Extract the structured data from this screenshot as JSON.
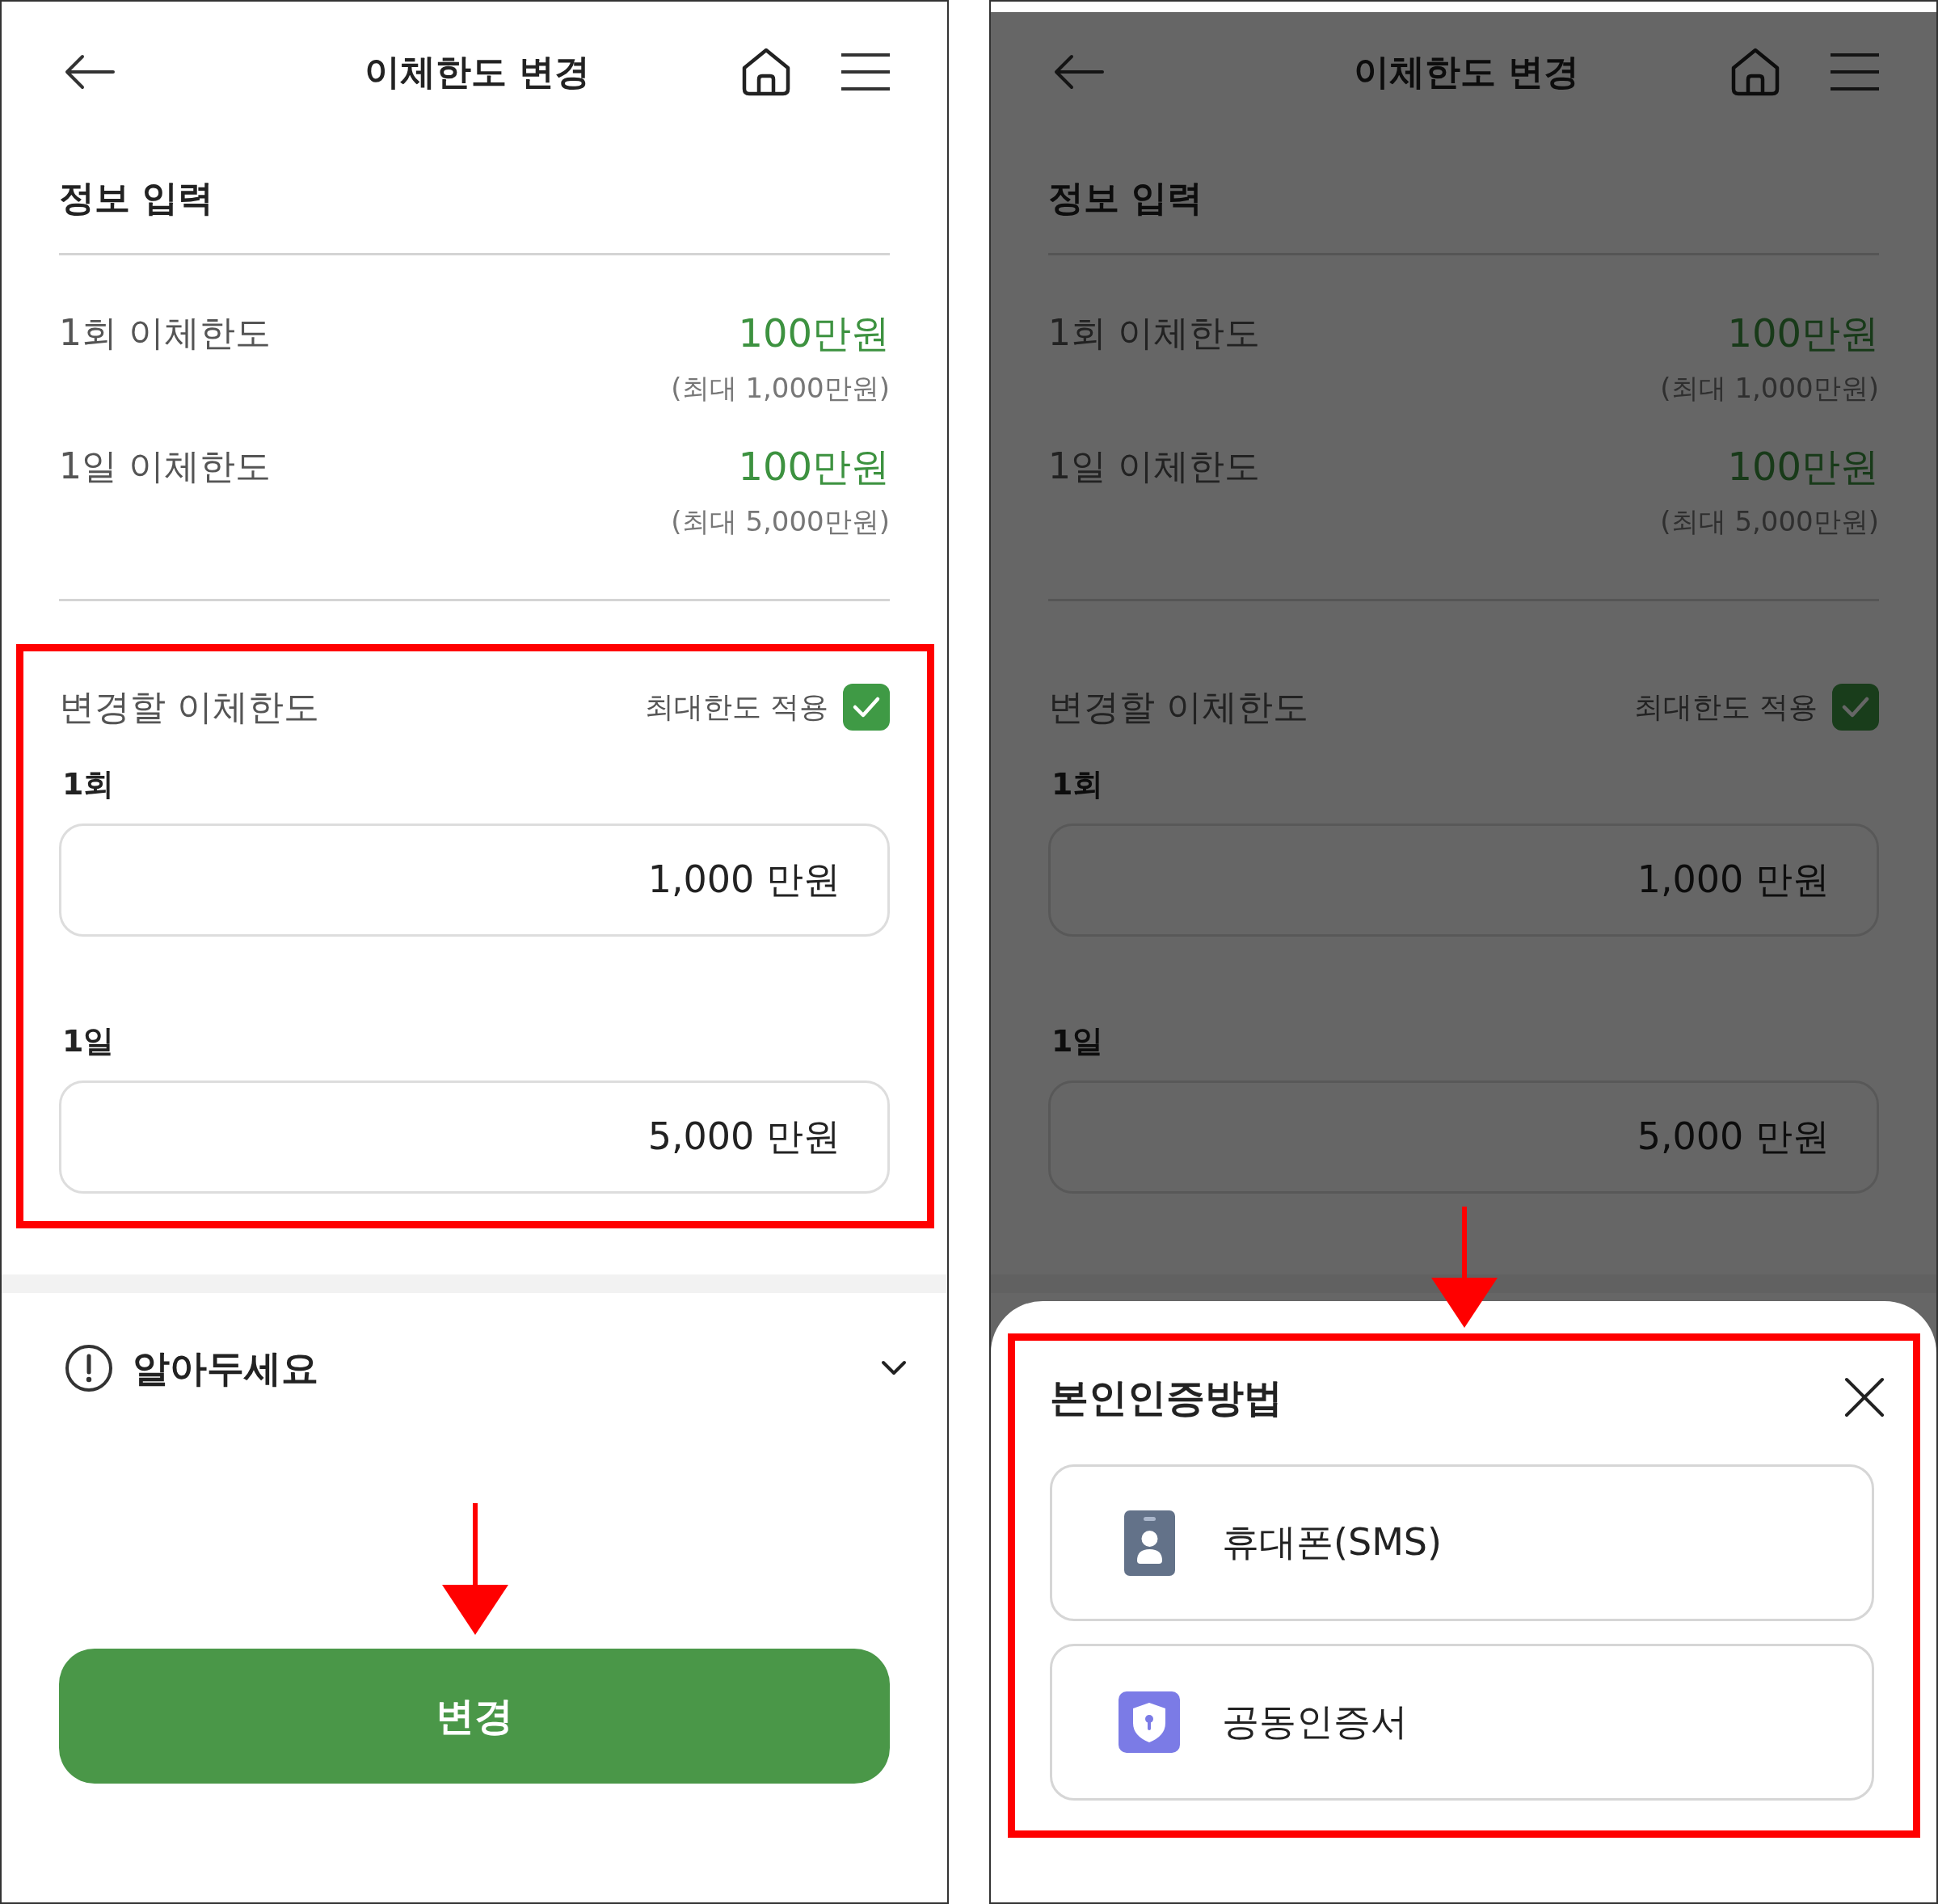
{
  "screens": [
    {
      "header": {
        "title": "이체한도 변경"
      },
      "section_title": "정보 입력",
      "limits": [
        {
          "label": "1회 이체한도",
          "value": "100만원",
          "max": "(최대 1,000만원)"
        },
        {
          "label": "1일 이체한도",
          "value": "100만원",
          "max": "(최대 5,000만원)"
        }
      ],
      "change": {
        "title": "변경할 이체한도",
        "max_limit": {
          "label": "최대한도 적용",
          "checked": true
        },
        "fields": [
          {
            "label": "1회",
            "value": "1,000 만원"
          },
          {
            "label": "1일",
            "value": "5,000 만원"
          }
        ]
      },
      "notice": {
        "title": "알아두세요",
        "expanded": false
      },
      "submit_button": "변경"
    },
    {
      "header": {
        "title": "이체한도 변경"
      },
      "section_title": "정보 입력",
      "limits": [
        {
          "label": "1회 이체한도",
          "value": "100만원",
          "max": "(최대 1,000만원)"
        },
        {
          "label": "1일 이체한도",
          "value": "100만원",
          "max": "(최대 5,000만원)"
        }
      ],
      "change": {
        "title": "변경할 이체한도",
        "max_limit": {
          "label": "최대한도 적용",
          "checked": true
        },
        "fields": [
          {
            "label": "1회",
            "value": "1,000 만원"
          },
          {
            "label": "1일",
            "value": "5,000 만원"
          }
        ]
      },
      "sheet": {
        "title": "본인인증방법",
        "options": [
          {
            "kind": "phone",
            "label": "휴대폰(SMS)"
          },
          {
            "kind": "certificate",
            "label": "공동인증서"
          }
        ]
      }
    }
  ]
}
